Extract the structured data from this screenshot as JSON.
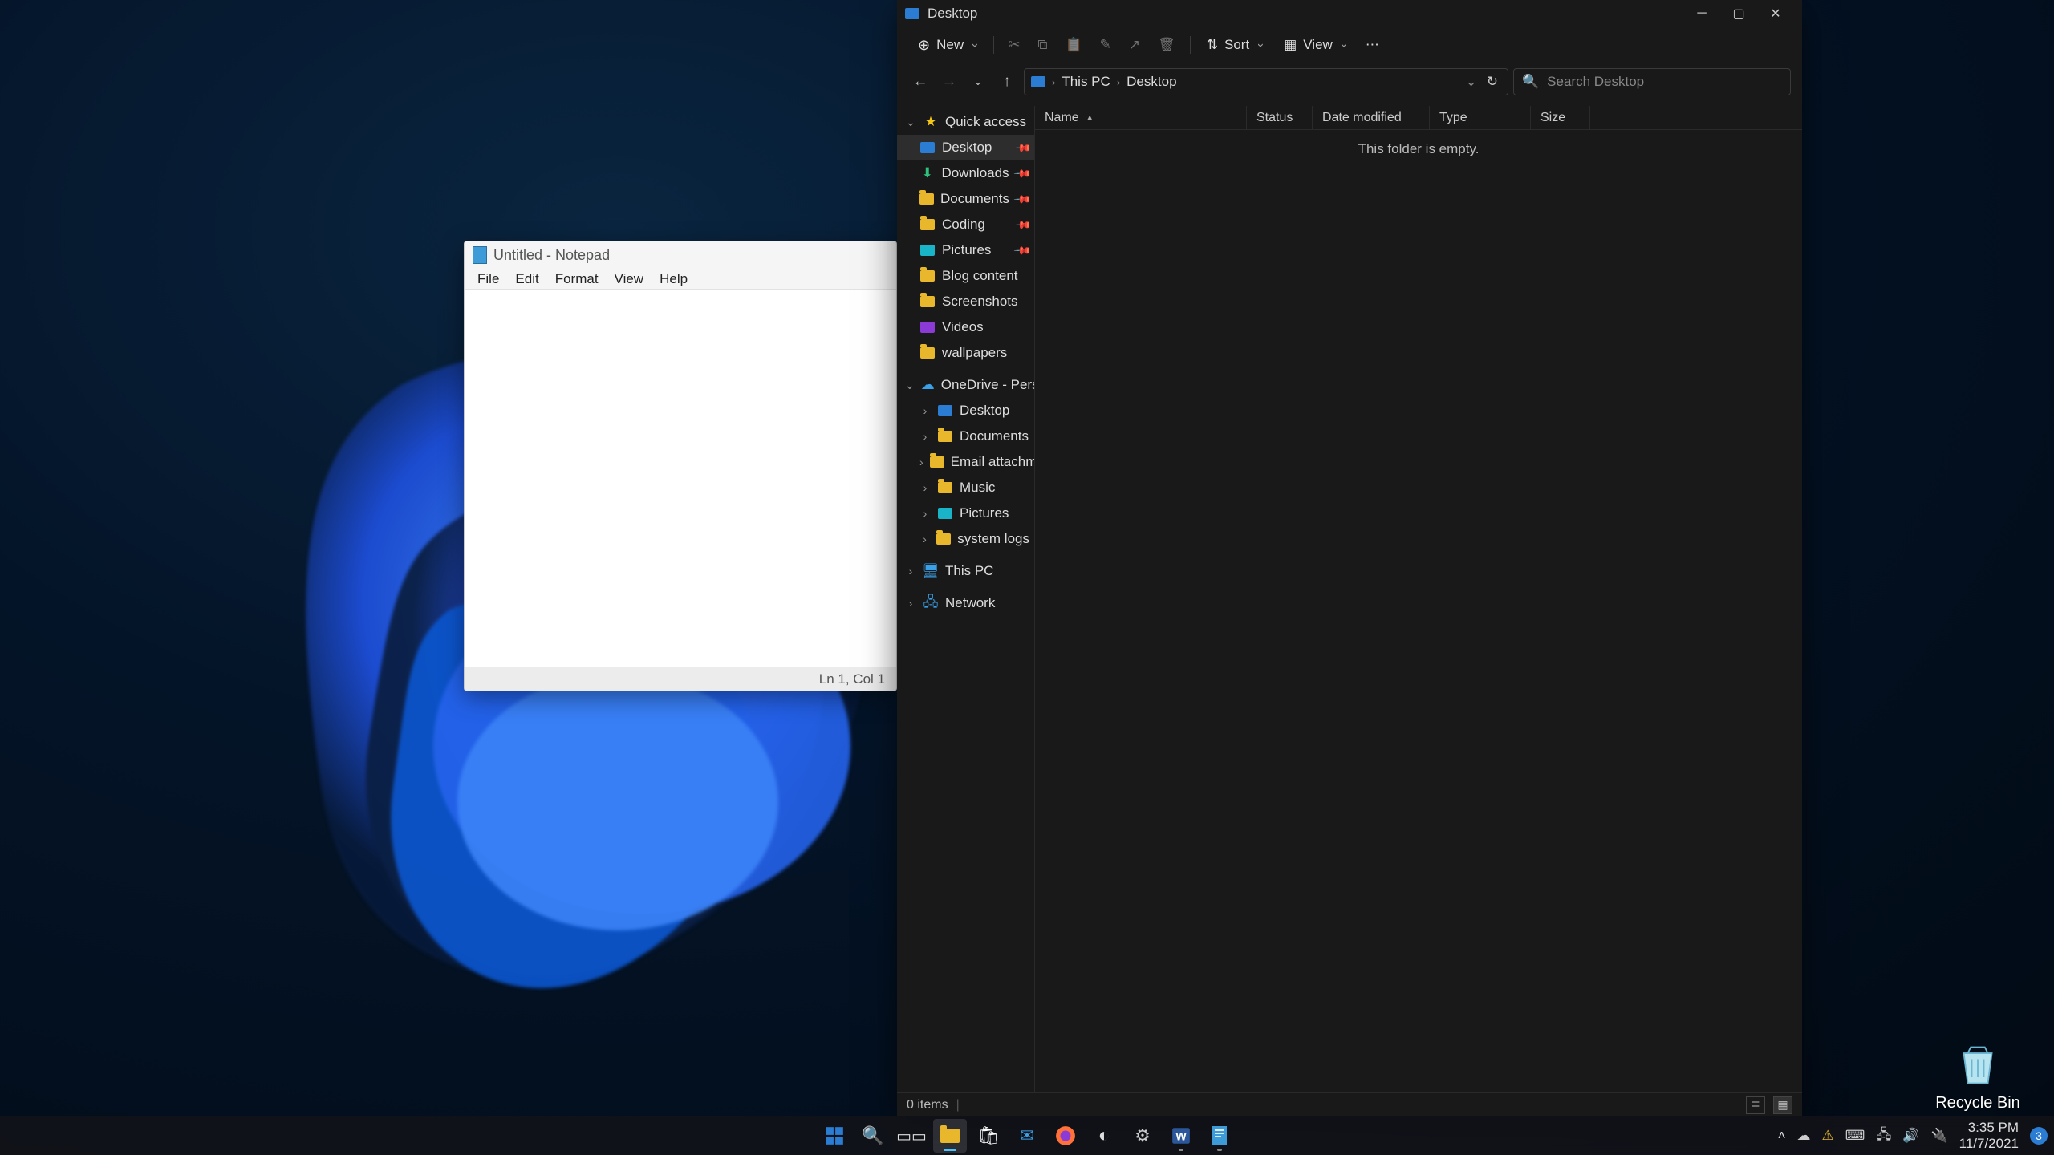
{
  "desktop": {
    "recycle_bin": "Recycle Bin"
  },
  "notepad": {
    "title": "Untitled - Notepad",
    "menus": [
      "File",
      "Edit",
      "Format",
      "View",
      "Help"
    ],
    "status": "Ln 1, Col 1"
  },
  "explorer": {
    "title": "Desktop",
    "toolbar": {
      "new": "New",
      "sort": "Sort",
      "view": "View"
    },
    "breadcrumb": [
      "This PC",
      "Desktop"
    ],
    "search_placeholder": "Search Desktop",
    "columns": {
      "name": "Name",
      "status": "Status",
      "date": "Date modified",
      "type": "Type",
      "size": "Size"
    },
    "empty_message": "This folder is empty.",
    "sidebar": {
      "quick_access": "Quick access",
      "quick_items": [
        {
          "label": "Desktop",
          "icon": "monitor",
          "pinned": true,
          "selected": true
        },
        {
          "label": "Downloads",
          "icon": "download",
          "pinned": true
        },
        {
          "label": "Documents",
          "icon": "folder",
          "pinned": true
        },
        {
          "label": "Coding",
          "icon": "folder",
          "pinned": true
        },
        {
          "label": "Pictures",
          "icon": "pic",
          "pinned": true
        },
        {
          "label": "Blog content",
          "icon": "folder"
        },
        {
          "label": "Screenshots",
          "icon": "folder"
        },
        {
          "label": "Videos",
          "icon": "vid"
        },
        {
          "label": "wallpapers",
          "icon": "folder"
        }
      ],
      "onedrive": "OneDrive - Personal",
      "onedrive_items": [
        {
          "label": "Desktop",
          "icon": "monitor"
        },
        {
          "label": "Documents",
          "icon": "folder"
        },
        {
          "label": "Email attachments",
          "icon": "folder"
        },
        {
          "label": "Music",
          "icon": "folder"
        },
        {
          "label": "Pictures",
          "icon": "pic"
        },
        {
          "label": "system logs",
          "icon": "folder"
        }
      ],
      "this_pc": "This PC",
      "network": "Network"
    },
    "status": "0 items"
  },
  "taskbar": {
    "time": "3:35 PM",
    "date": "11/7/2021",
    "notif_count": "3"
  }
}
